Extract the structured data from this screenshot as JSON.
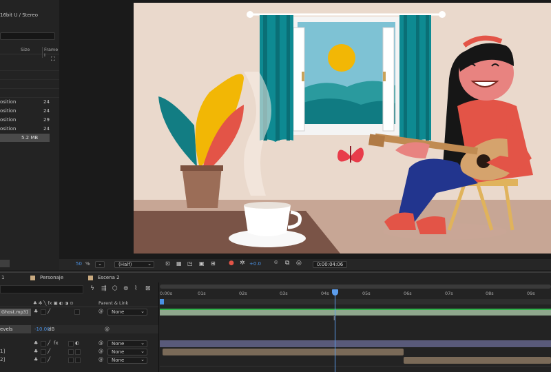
{
  "project_panel": {
    "audio_info": "16bit U / Stereo",
    "col_size": "Size",
    "col_frame": "Frame I",
    "items": [
      {
        "label": "osition",
        "value": "24"
      },
      {
        "label": "osition",
        "value": "24"
      },
      {
        "label": "osition",
        "value": "29"
      },
      {
        "label": "osition",
        "value": "24"
      }
    ],
    "total_size": "5.2 MB"
  },
  "viewer_bar": {
    "zoom": "50",
    "zoom_unit": "%",
    "resolution": "(Half)",
    "exposure": "+0.0",
    "timecode": "0:00:04:06"
  },
  "tabs": [
    {
      "label": "1"
    },
    {
      "label": "Personaje"
    },
    {
      "label": "Escena 2"
    }
  ],
  "timeline": {
    "parent_header": "Parent & Link",
    "layers": [
      {
        "name": "Ghost.mp3]",
        "parent": "None"
      },
      {
        "name": "evels",
        "value": "-10.00",
        "unit": "dB"
      },
      {
        "name": "",
        "parent": "None"
      },
      {
        "name": "1]",
        "parent": "None"
      },
      {
        "name": "2]",
        "parent": "None"
      }
    ],
    "ruler": [
      "0:00s",
      "01s",
      "02s",
      "03s",
      "04s",
      "05s",
      "06s",
      "07s",
      "08s",
      "09s"
    ],
    "playhead_seconds": 4.25,
    "ruler_max_seconds": 9.5
  },
  "colors": {
    "accent": "#4a90e2",
    "playhead": "#5c9ded",
    "scene_wall": "#ead9cc",
    "audio_bar": "#8fa88d",
    "layer_bar": "#595a7a"
  }
}
